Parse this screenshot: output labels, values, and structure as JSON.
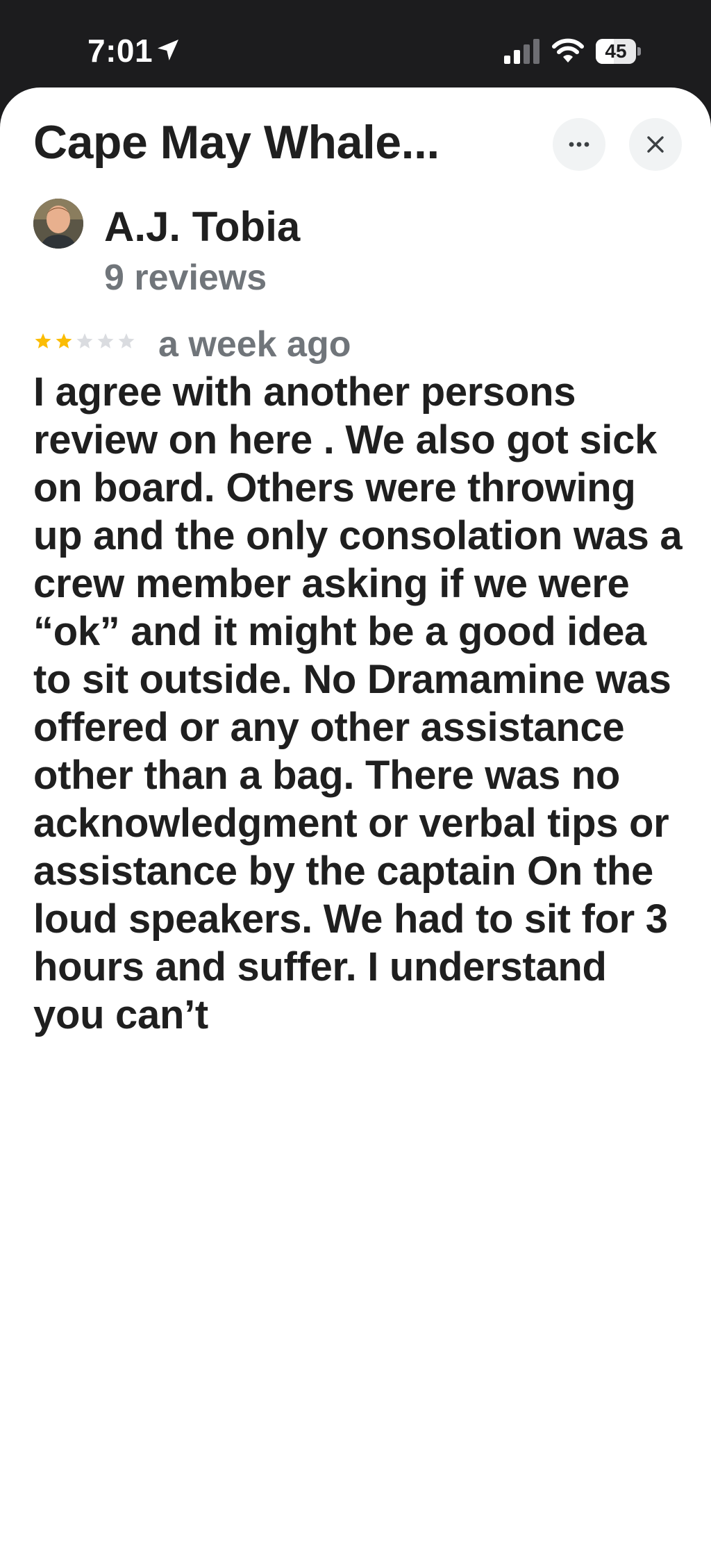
{
  "status_bar": {
    "time": "7:01",
    "battery_level": "45",
    "battery_fraction": 0.45,
    "icons": [
      "location-arrow-icon",
      "cellular-signal-icon",
      "wifi-icon",
      "battery-icon"
    ]
  },
  "sheet": {
    "title": "Cape May Whale...",
    "more_icon": "more-horizontal-icon",
    "close_icon": "close-icon"
  },
  "review": {
    "reviewer_name": "A.J. Tobia",
    "reviewer_reviews": "9 reviews",
    "rating": 2,
    "rating_max": 5,
    "date": "a week ago",
    "text": "I agree with another persons review on here . We also got sick on board. Others were throwing up and the only consolation was a crew member asking if we were “ok” and it might be a good idea to sit outside. No Dramamine was offered or any other assistance other than a bag. There was no acknowledgment or verbal tips or assistance by the captain On the loud speakers. We had to sit for 3 hours and suffer. I understand you can’t"
  },
  "colors": {
    "status_bar_bg": "#1c1c1e",
    "sheet_bg": "#ffffff",
    "text_primary": "#1f1f1f",
    "text_secondary": "#70757a",
    "star_filled": "#fbbc04",
    "star_empty": "#dadce0",
    "button_bg": "#f1f3f4"
  }
}
